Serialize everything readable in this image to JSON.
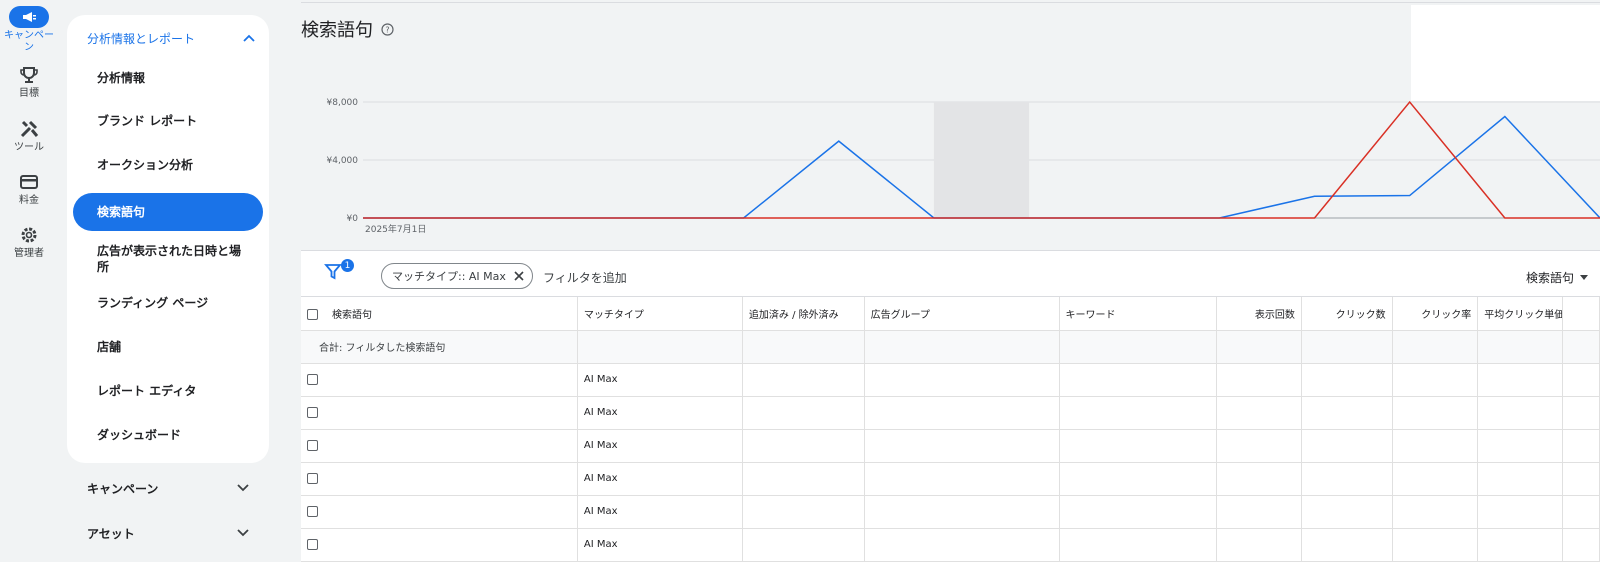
{
  "rail": [
    {
      "label": "キャンペーン",
      "icon": "megaphone-icon",
      "active": true
    },
    {
      "label": "目標",
      "icon": "trophy-icon"
    },
    {
      "label": "ツール",
      "icon": "tools-icon"
    },
    {
      "label": "料金",
      "icon": "credit-card-icon"
    },
    {
      "label": "管理者",
      "icon": "gear-icon"
    }
  ],
  "nav": {
    "section_title": "分析情報とレポート",
    "items": [
      "分析情報",
      "ブランド レポート",
      "オークション分析",
      "検索語句",
      "広告が表示された日時と場所",
      "ランディング ページ",
      "店舗",
      "レポート エディタ",
      "ダッシュボード"
    ],
    "active_index": 3,
    "collapsed_sections": [
      "キャンペーン",
      "アセット"
    ]
  },
  "page": {
    "title": "検索語句",
    "help_icon": "help-icon"
  },
  "chart_data": {
    "type": "line",
    "x": [
      0,
      1,
      2,
      3,
      4,
      5,
      6,
      7,
      8,
      9,
      10,
      11,
      12,
      13
    ],
    "x_tick_labels": [
      "2025年7月1日"
    ],
    "y_tick_labels": [
      "¥0",
      "¥4,000",
      "¥8,000"
    ],
    "ylim": [
      0,
      8000
    ],
    "series": [
      {
        "color": "#1a73e8",
        "values": [
          0,
          0,
          0,
          0,
          0,
          5300,
          0,
          0,
          0,
          0,
          1500,
          1550,
          7000,
          0
        ]
      },
      {
        "color": "#d93025",
        "values": [
          0,
          0,
          0,
          0,
          0,
          0,
          0,
          0,
          0,
          0,
          0,
          8000,
          0,
          0
        ]
      }
    ],
    "highlight_band_index": 6
  },
  "filters": {
    "count": "1",
    "chip_label": "マッチタイプ:: AI Max",
    "add_filter": "フィルタを追加",
    "view_selector": "検索語句"
  },
  "table": {
    "headers": [
      "検索語句",
      "マッチタイプ",
      "追加済み / 除外済み",
      "広告グループ",
      "キーワード",
      "表示回数",
      "クリック数",
      "クリック率",
      "平均クリック単価"
    ],
    "total_label": "合計: フィルタした検索語句",
    "rows": [
      {
        "match": "AI Max"
      },
      {
        "match": "AI Max"
      },
      {
        "match": "AI Max"
      },
      {
        "match": "AI Max"
      },
      {
        "match": "AI Max"
      },
      {
        "match": "AI Max"
      }
    ]
  }
}
